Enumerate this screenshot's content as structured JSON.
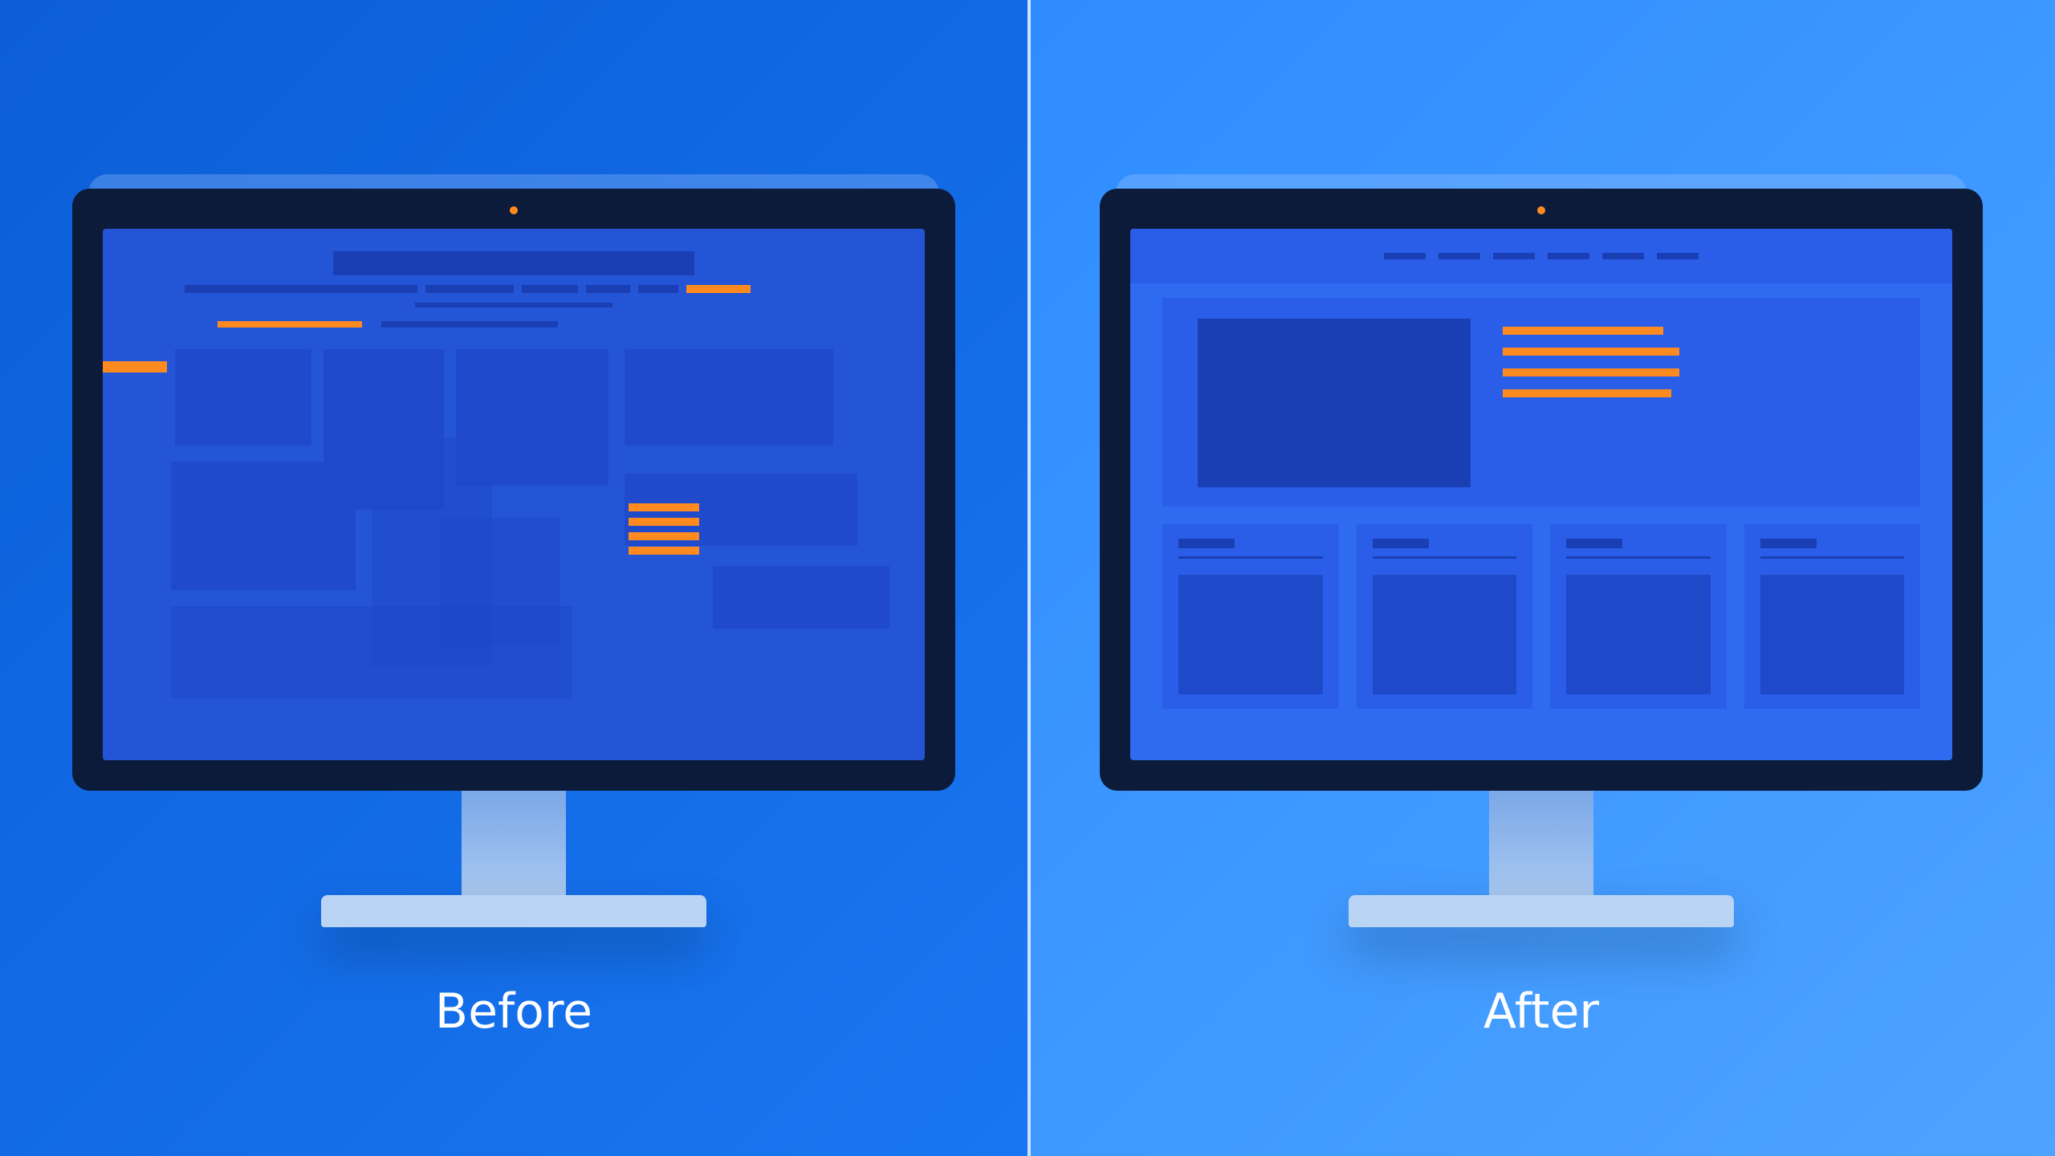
{
  "labels": {
    "before": "Before",
    "after": "After"
  },
  "colors": {
    "accent": "#ff8a1f",
    "dark_block": "#1a3fb5",
    "block": "#1e49c9",
    "bezel": "#0d1b3a"
  }
}
